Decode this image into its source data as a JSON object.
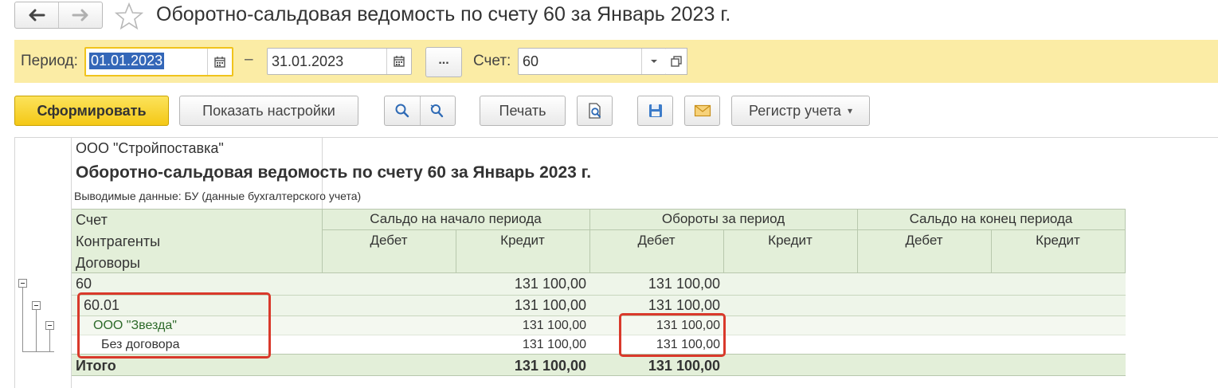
{
  "window": {
    "title": "Оборотно-сальдовая ведомость по счету 60 за Январь 2023 г.",
    "back_icon": "arrow-left-icon",
    "forward_icon": "arrow-right-icon",
    "favorite_icon": "star-icon"
  },
  "filters": {
    "period_label": "Период:",
    "date_from": "01.01.2023",
    "dash": "–",
    "date_to": "31.01.2023",
    "more_label": "...",
    "account_label": "Счет:",
    "account_value": "60"
  },
  "toolbar": {
    "generate": "Сформировать",
    "show_settings": "Показать настройки",
    "print": "Печать",
    "register": "Регистр учета"
  },
  "report": {
    "company": "ООО \"Стройпоставка\"",
    "title": "Оборотно-сальдовая ведомость по счету 60 за Январь 2023 г.",
    "subtitle": "Выводимые данные: БУ (данные бухгалтерского учета)",
    "headers": {
      "row_labels": [
        "Счет",
        "Контрагенты",
        "Договоры"
      ],
      "groups": [
        "Сальдо на начало периода",
        "Обороты за период",
        "Сальдо на конец периода"
      ],
      "debit": "Дебет",
      "credit": "Кредит"
    },
    "rows": [
      {
        "label": "60",
        "open_credit": "131 100,00",
        "turn_debit": "131 100,00"
      },
      {
        "label": "60.01",
        "open_credit": "131 100,00",
        "turn_debit": "131 100,00"
      },
      {
        "label": "ООО \"Звезда\"",
        "open_credit": "131 100,00",
        "turn_debit": "131 100,00"
      },
      {
        "label": "Без договора",
        "open_credit": "131 100,00",
        "turn_debit": "131 100,00"
      }
    ],
    "total": {
      "label": "Итого",
      "open_credit": "131 100,00",
      "turn_debit": "131 100,00"
    }
  },
  "colors": {
    "filter_panel": "#fbeca5",
    "header_bg": "#e3efd9",
    "primary_button": "#f4c816",
    "highlight": "#d9392b"
  }
}
